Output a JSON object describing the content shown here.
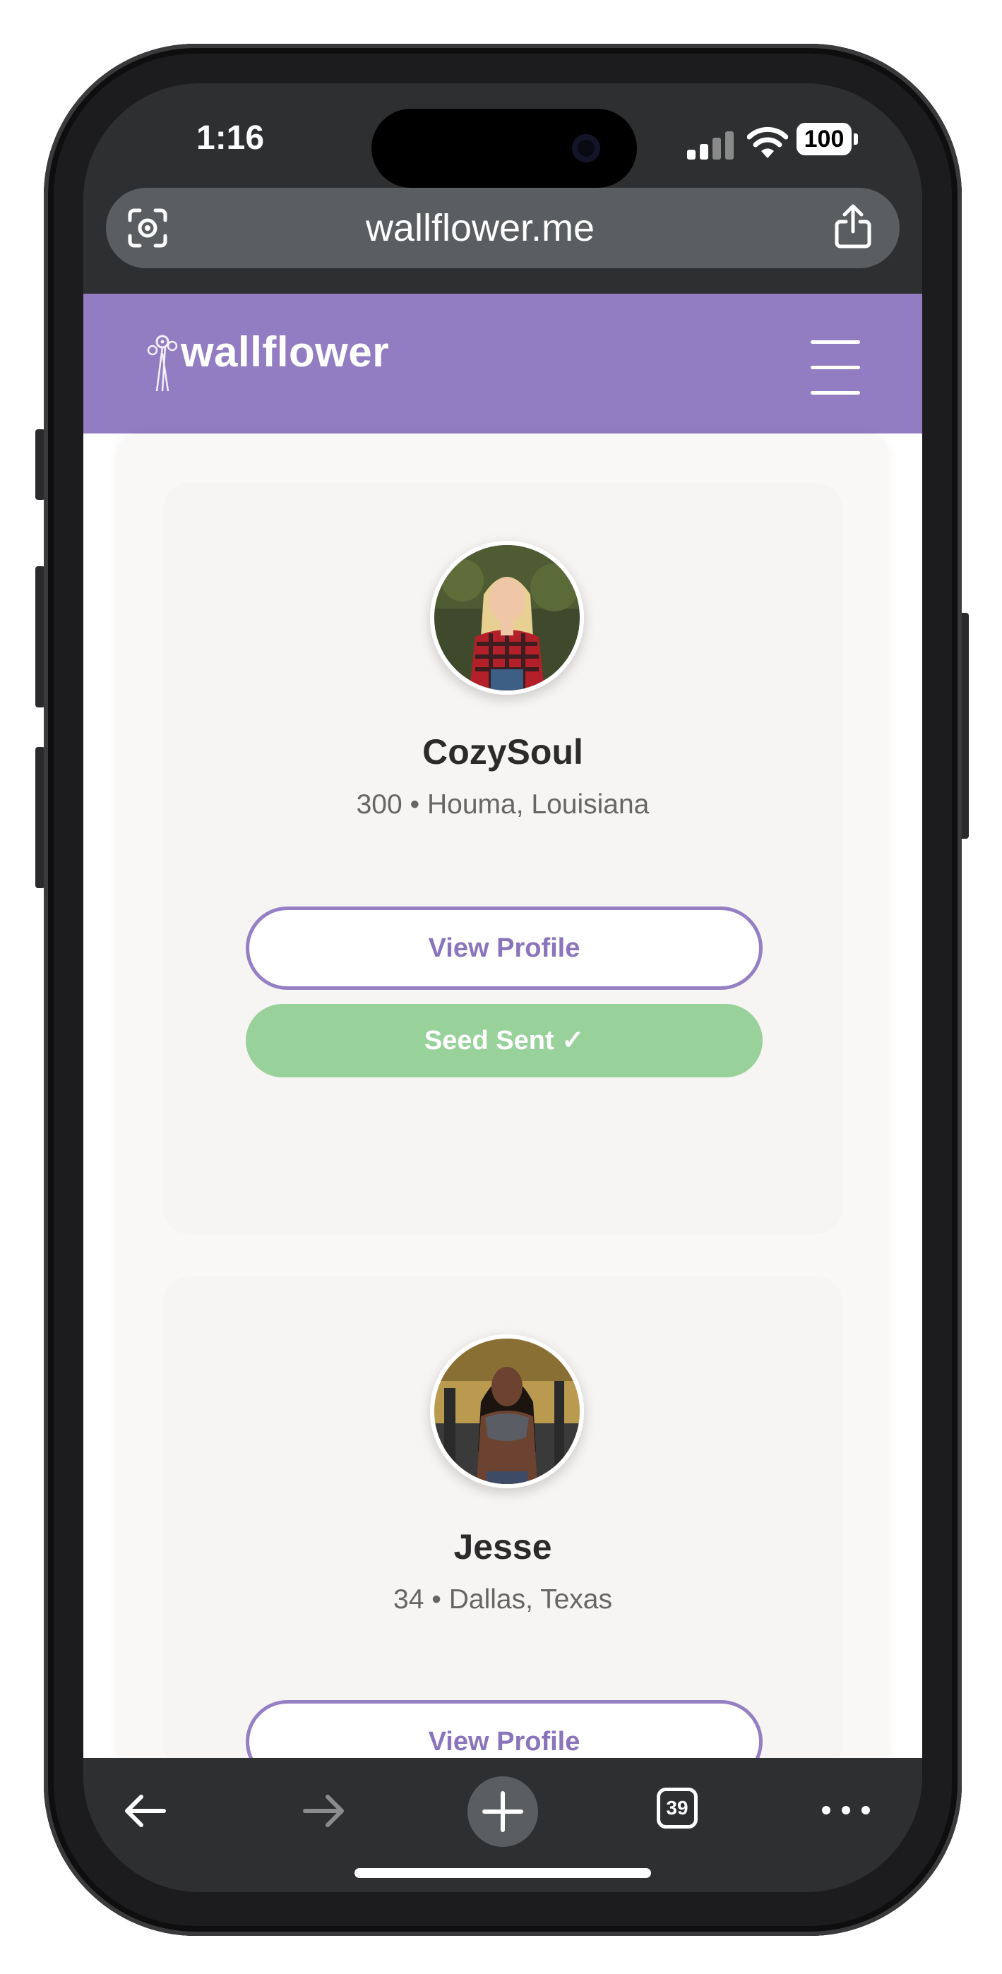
{
  "status_bar": {
    "time": "1:16",
    "battery": "100"
  },
  "browser": {
    "url": "wallflower.me",
    "tab_count": "39"
  },
  "site": {
    "logo_text": "wallflower"
  },
  "profiles": [
    {
      "name": "CozySoul",
      "meta": "300 • Houma, Louisiana",
      "view_label": "View Profile",
      "seed_label": "Seed Sent ✓"
    },
    {
      "name": "Jesse",
      "meta": "34 • Dallas, Texas",
      "view_label": "View Profile"
    }
  ],
  "colors": {
    "brand_purple": "#937dc2",
    "seed_green": "#99d19b",
    "card_bg": "#f7f5f3"
  }
}
